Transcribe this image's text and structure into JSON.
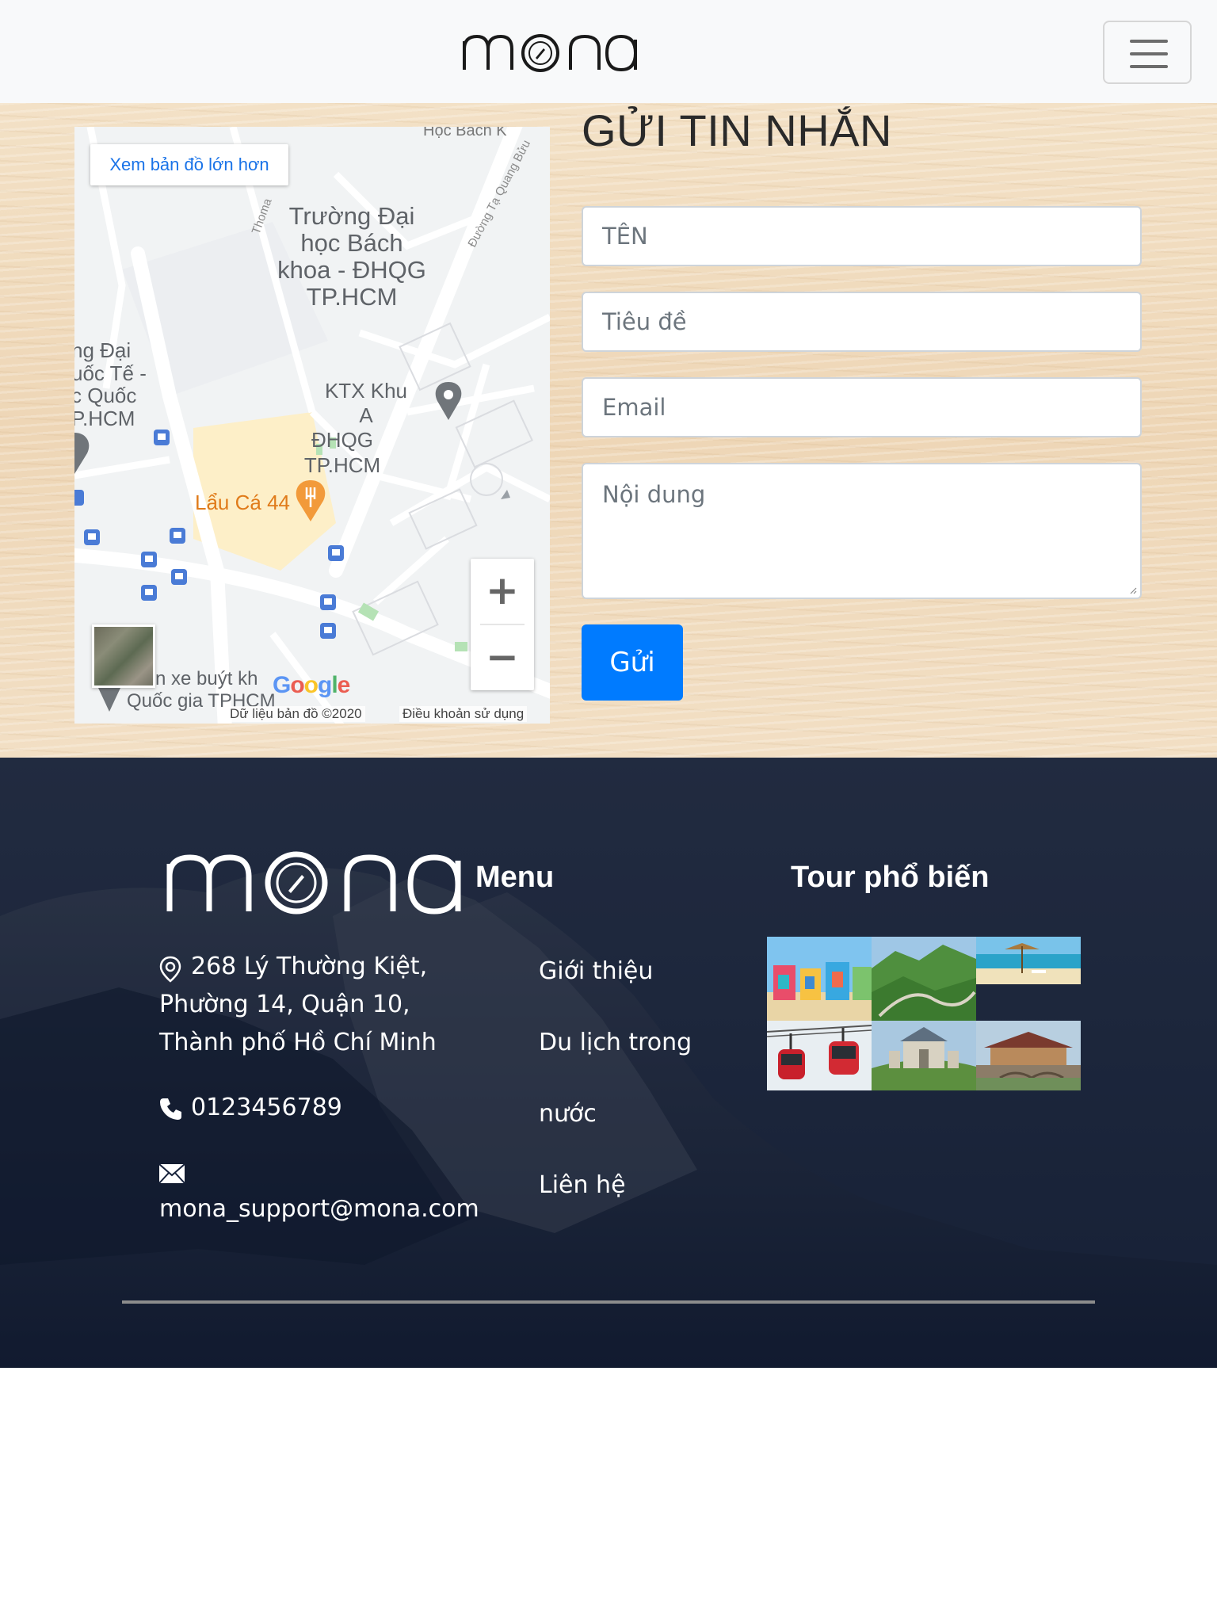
{
  "brand": {
    "logo_text": "mona"
  },
  "navbar": {
    "toggler_icon": "hamburger-icon"
  },
  "map": {
    "larger_map_link": "Xem bản đồ lớn hơn",
    "labels": {
      "university": [
        "Trường Đại",
        "học Bách",
        "khoa - ĐHQG",
        "TP.HCM"
      ],
      "dorm": [
        "KTX Khu A",
        "ĐHQG TP.HCM"
      ],
      "intl_uni": [
        "ng Đại",
        "uốc Tế -",
        "c Quốc",
        "P.HCM"
      ],
      "restaurant": "Lẩu Cá 44",
      "road_thomas": "Thoma",
      "road_tqb": "Đường Tạ Quang Bửu",
      "bus_station": "n xe buýt kh",
      "national": "Quốc gia TPHCM",
      "top_cut": "Học Bách K"
    },
    "zoom_in": "+",
    "zoom_out": "−",
    "map_data": "Dữ liệu bản đồ ©2020",
    "terms": "Điều khoản sử dụng",
    "google": [
      "G",
      "o",
      "o",
      "g",
      "l",
      "e"
    ]
  },
  "contact_form": {
    "title": "GỬI TIN NHẮN",
    "name_placeholder": "TÊN",
    "subject_placeholder": "Tiêu đề",
    "email_placeholder": "Email",
    "message_placeholder": "Nội dung",
    "submit_label": "Gửi"
  },
  "footer": {
    "address_lines": [
      "268 Lý Thường Kiệt,",
      "Phường 14, Quận 10,",
      "Thành phố Hồ Chí Minh"
    ],
    "phone": "0123456789",
    "email": "mona_support@mona.com",
    "menu_heading": "Menu",
    "menu_items": [
      "Giới thiệu",
      "Du lịch trong",
      "nước",
      "Liên hệ"
    ],
    "tours_heading": "Tour phổ biến",
    "icons": {
      "location": "map-pin-icon",
      "phone": "phone-icon",
      "email": "envelope-icon"
    }
  },
  "colors": {
    "primary": "#007bff",
    "navbar_bg": "#f8f9fa",
    "footer_bg": "#16213a",
    "link_blue": "#1a73e8"
  }
}
